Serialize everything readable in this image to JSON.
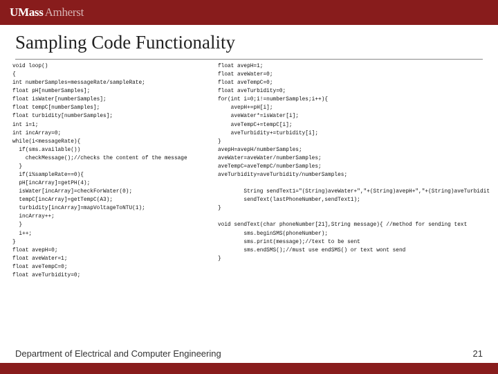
{
  "header": {
    "logo_u": "U",
    "logo_mass": "Mass",
    "logo_amherst": "Amherst"
  },
  "title": "Sampling Code Functionality",
  "code_left": "void loop()\n{\nint numberSamples=messageRate/sampleRate;\nfloat pH[numberSamples];\nfloat isWater[numberSamples];\nfloat tempC[numberSamples];\nfloat turbidity[numberSamples];\nint i=1;\nint incArray=0;\nwhile(i<messageRate){\n  if(sms.available())\n    checkMessage();//checks the content of the message\n  }\n  if(i%sampleRate==0){\n  pH[incArray]=getPH(4);\n  isWater[incArray]=checkForWater(0);\n  tempC[incArray]=getTempC(A3);\n  turbidity[incArray]=mapVoltageToNTU(1);\n  incArray++;\n  }\n  i++;\n}\nfloat avepH=0;\nfloat aveWater=1;\nfloat aveTempC=0;\nfloat aveTurbidity=0;",
  "code_right_a": "float avepH=1;\nfloat aveWater=0;\nfloat aveTempC=0;\nfloat aveTurbidity=0;\nfor(int i=0;i!=numberSamples;i++){\n    avepH+=pH[i];\n    aveWater*=isWater[i];\n    aveTempC+=tempC[i];\n    aveTurbidity+=turbidity[i];\n}\navepH=avepH/numberSamples;\naveWater=aveWater/numberSamples;\naveTempC=aveTempC/numberSamples;\naveTurbidity=aveTurbidity/numberSamples;\n\n        String sendText1=\"(String)aveWater+\",\"+(String)avepH+\",\"+(String)aveTurbidit\n        sendText(lastPhoneNumber,sendText1);\n}\n",
  "code_right_b": "\nvoid sendText(char phoneNumber[21],String message){ //method for sending text\n        sms.beginSMS(phoneNumber);\n        sms.print(message);//text to be sent\n        sms.endSMS();//must use endSMS() or text wont send\n}",
  "footer": {
    "dept": "Department of Electrical and Computer Engineering",
    "page": "21"
  }
}
